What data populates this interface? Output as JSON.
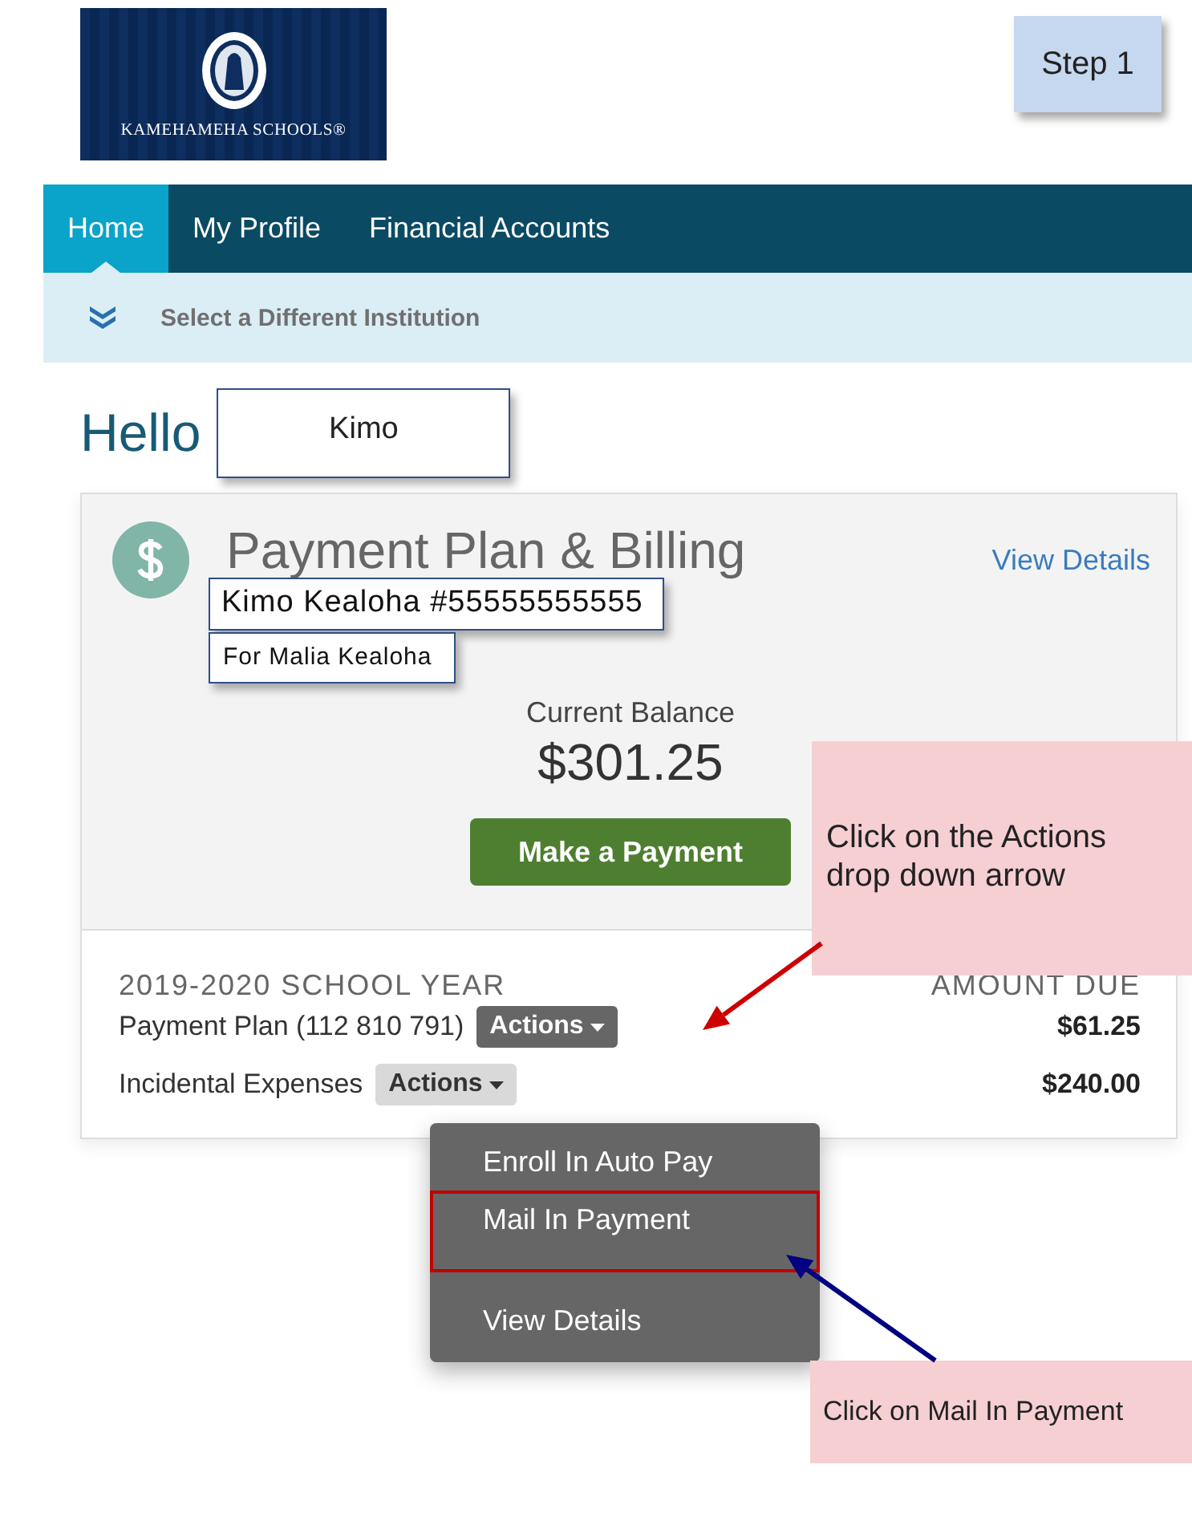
{
  "header": {
    "logo_text": "KAMEHAMEHA SCHOOLS®",
    "step_label": "Step 1"
  },
  "nav": [
    {
      "label": "Home",
      "selected": true
    },
    {
      "label": "My Profile",
      "selected": false
    },
    {
      "label": "Financial Accounts",
      "selected": false
    }
  ],
  "institution_link": "Select a Different Institution",
  "greeting": {
    "text": "Hello",
    "name": "Kimo"
  },
  "card": {
    "title": "Payment Plan & Billing",
    "view_details": "View Details",
    "account": "Kimo Kealoha #55555555555",
    "student": "For Malia Kealoha",
    "balance_label": "Current Balance",
    "balance": "$301.25",
    "pay_button": "Make a Payment",
    "year": "2019-2020 SCHOOL YEAR",
    "amount_header": "AMOUNT DUE",
    "items": [
      {
        "label": "Payment Plan (112 810 791)",
        "actions": "Actions",
        "amount": "$61.25",
        "active": true
      },
      {
        "label": "Incidental Expenses",
        "actions": "Actions",
        "amount": "$240.00",
        "active": false
      }
    ]
  },
  "menu": {
    "items": [
      {
        "label": "Enroll In Auto Pay",
        "highlighted": false,
        "separator_before": false
      },
      {
        "label": "Mail In Payment",
        "highlighted": true,
        "separator_before": false
      },
      {
        "label": "View Details",
        "highlighted": false,
        "separator_before": true
      }
    ]
  },
  "callouts": [
    {
      "text": "Click on the Actions drop down arrow",
      "color": "#cc0000"
    },
    {
      "text": "Click on Mail In Payment",
      "color": "#000080"
    }
  ]
}
